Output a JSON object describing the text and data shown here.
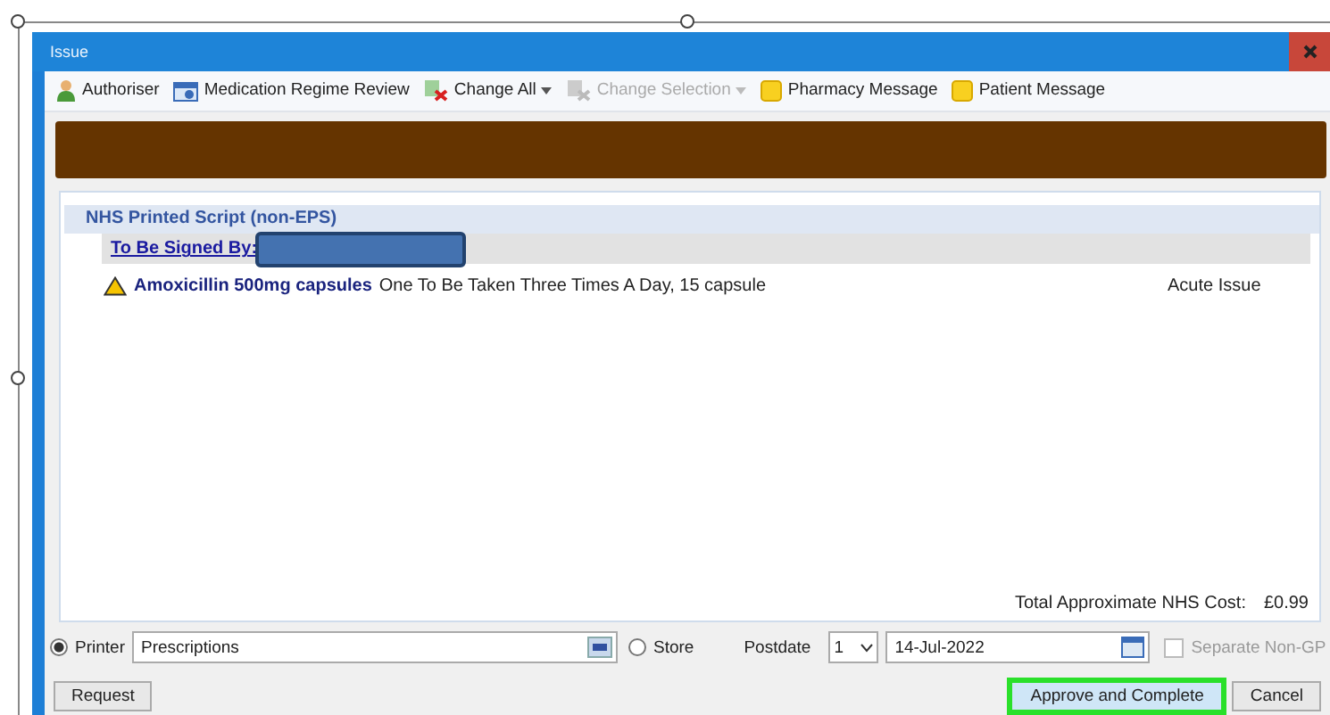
{
  "window": {
    "title": "Issue"
  },
  "toolbar": [
    {
      "label": "Authoriser",
      "kind": "person",
      "disabled": false,
      "dropdown": false
    },
    {
      "label": "Medication Regime Review",
      "kind": "calendar",
      "disabled": false,
      "dropdown": false
    },
    {
      "label": "Change All",
      "kind": "change",
      "disabled": false,
      "dropdown": true
    },
    {
      "label": "Change Selection",
      "kind": "change",
      "disabled": true,
      "dropdown": true
    },
    {
      "label": "Pharmacy Message",
      "kind": "note",
      "disabled": false,
      "dropdown": false
    },
    {
      "label": "Patient Message",
      "kind": "note",
      "disabled": false,
      "dropdown": false
    }
  ],
  "script": {
    "header": "NHS Printed Script (non-EPS)",
    "signed_by_label": "To Be Signed By:",
    "items": [
      {
        "warning": true,
        "name": "Amoxicillin 500mg capsules",
        "directions": "One To Be Taken Three Times A Day, 15 capsule",
        "issue_type": "Acute Issue"
      }
    ],
    "total_label": "Total Approximate NHS Cost:",
    "total_value": "£0.99"
  },
  "output": {
    "options": [
      {
        "label": "Printer",
        "selected": true
      },
      {
        "label": "Store",
        "selected": false
      }
    ],
    "printer_value": "Prescriptions",
    "postdate_label": "Postdate",
    "postdate_days": "1",
    "date": "14-Jul-2022",
    "separate": {
      "label": "Separate Non-GP",
      "checked": false,
      "disabled": true
    }
  },
  "buttons": [
    {
      "label": "Request",
      "kind": "left",
      "highlighted": false
    },
    {
      "label": "Approve and Complete",
      "kind": "right",
      "highlighted": true
    },
    {
      "label": "Cancel",
      "kind": "right",
      "highlighted": false
    }
  ]
}
